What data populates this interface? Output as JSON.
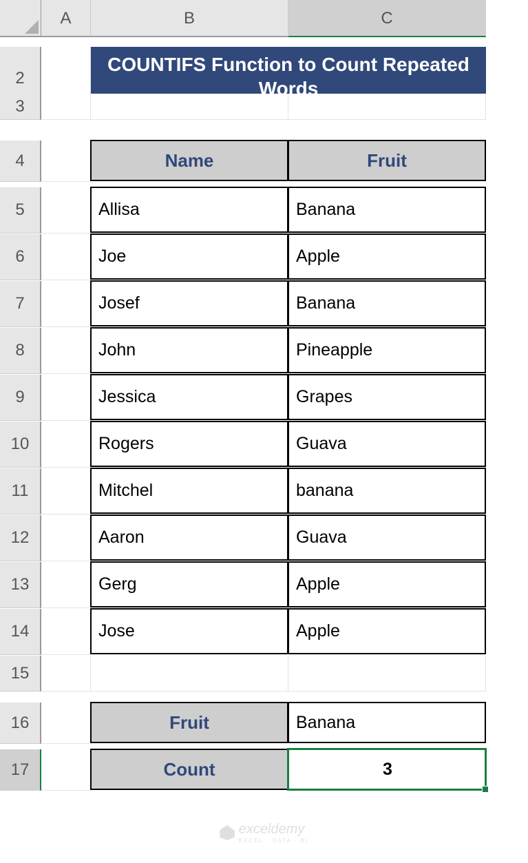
{
  "columns": [
    "A",
    "B",
    "C"
  ],
  "rows": [
    "2",
    "3",
    "4",
    "5",
    "6",
    "7",
    "8",
    "9",
    "10",
    "11",
    "12",
    "13",
    "14",
    "15",
    "16",
    "17"
  ],
  "title": "COUNTIFS Function to Count Repeated Words",
  "selected_cell": "C17",
  "table": {
    "headers": {
      "name": "Name",
      "fruit": "Fruit"
    },
    "rows": [
      {
        "name": "Allisa",
        "fruit": "Banana"
      },
      {
        "name": "Joe",
        "fruit": "Apple"
      },
      {
        "name": "Josef",
        "fruit": "Banana"
      },
      {
        "name": "John",
        "fruit": "Pineapple"
      },
      {
        "name": "Jessica",
        "fruit": "Grapes"
      },
      {
        "name": "Rogers",
        "fruit": "Guava"
      },
      {
        "name": "Mitchel",
        "fruit": "banana"
      },
      {
        "name": "Aaron",
        "fruit": "Guava"
      },
      {
        "name": "Gerg",
        "fruit": "Apple"
      },
      {
        "name": "Jose",
        "fruit": "Apple"
      }
    ]
  },
  "summary": {
    "fruit_label": "Fruit",
    "fruit_value": "Banana",
    "count_label": "Count",
    "count_value": "3"
  },
  "watermark": {
    "brand": "exceldemy",
    "tag": "EXCEL · DATA · BI"
  }
}
